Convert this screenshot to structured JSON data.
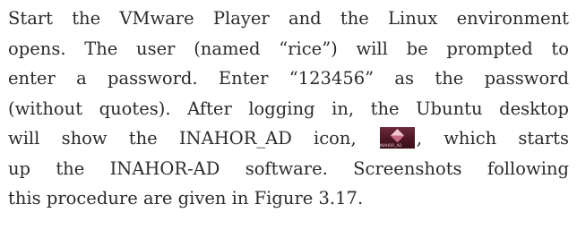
{
  "paragraph": {
    "line1": "Start the VMware Player and the Linux environment",
    "line2": "opens. The user (named “rice”) will be prompted to",
    "line3": "enter a password. Enter “123456” as the password",
    "line4": "(without quotes). After logging in, the Ubuntu desktop",
    "line5_before": "will show the INAHOR_AD icon,",
    "line5_after": ", which starts",
    "line6": "up the INAHOR-AD software. Screenshots following",
    "line7": "this procedure are given in Figure 3.17."
  },
  "icon": {
    "name": "inahor-ad-icon",
    "caption": "INAHOR_AD",
    "colors": {
      "background": "#4a1522",
      "diamond_top": "#f2c7d3",
      "diamond_bottom": "#c76a86"
    }
  }
}
